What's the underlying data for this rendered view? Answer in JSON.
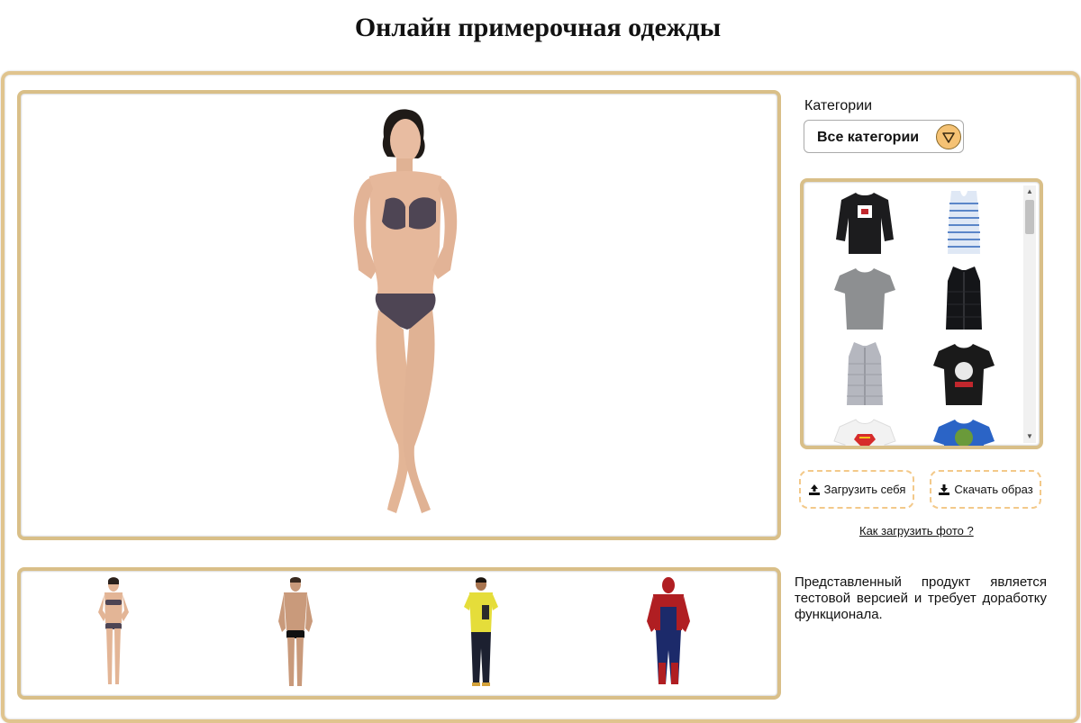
{
  "page": {
    "title": "Онлайн примерочная одежды"
  },
  "categories": {
    "label": "Категории",
    "selected": "Все категории"
  },
  "catalog": {
    "items": [
      {
        "name": "black-sweatshirt",
        "color": "#1c1c1e"
      },
      {
        "name": "striped-tank-top",
        "color": "#5b86c8"
      },
      {
        "name": "grey-tshirt",
        "color": "#8d8f91"
      },
      {
        "name": "black-vest",
        "color": "#141518"
      },
      {
        "name": "grey-vest",
        "color": "#b5b7bf"
      },
      {
        "name": "black-print-tshirt",
        "color": "#1a1a1a"
      },
      {
        "name": "white-superman-tshirt",
        "color": "#f2f2f2"
      },
      {
        "name": "blue-print-tshirt",
        "color": "#2b64c6"
      }
    ]
  },
  "actions": {
    "upload_label": "Загрузить себя",
    "download_label": "Скачать образ"
  },
  "help_link": "Как загрузить фото ?",
  "notice": "Представленный продукт является тестовой версией и требует доработку функционала.",
  "models": [
    {
      "name": "woman-bikini"
    },
    {
      "name": "man-swimwear"
    },
    {
      "name": "boy-yellow-tshirt"
    },
    {
      "name": "spiderman"
    }
  ],
  "colors": {
    "accent_border": "#d9bf88",
    "button_border": "#f3c98a",
    "dropdown_arrow": "#f5c274"
  }
}
